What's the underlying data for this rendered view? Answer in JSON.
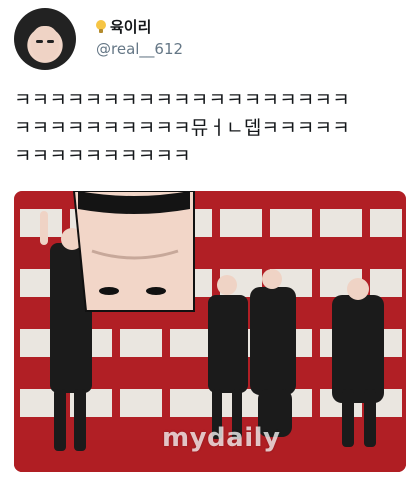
{
  "user": {
    "display_name": "육이리",
    "handle": "@real__612",
    "name_emoji": "lightbulb-icon"
  },
  "tweet": {
    "lines": [
      "ㅋㅋㅋㅋㅋㅋㅋㅋㅋㅋㅋㅋㅋㅋㅋㅋㅋㅋㅋ",
      "ㅋㅋㅋㅋㅋㅋㅋㅋㅋㅋ뮤ㅓㄴ뎁ㅋㅋㅋㅋㅋ",
      "ㅋㅋㅋㅋㅋㅋㅋㅋㅋㅋ"
    ]
  },
  "media": {
    "watermark": "mydaily",
    "accent_colors": {
      "backdrop": "#b11f25",
      "carpet": "#b01e23",
      "frame": "#eae6e0"
    }
  }
}
